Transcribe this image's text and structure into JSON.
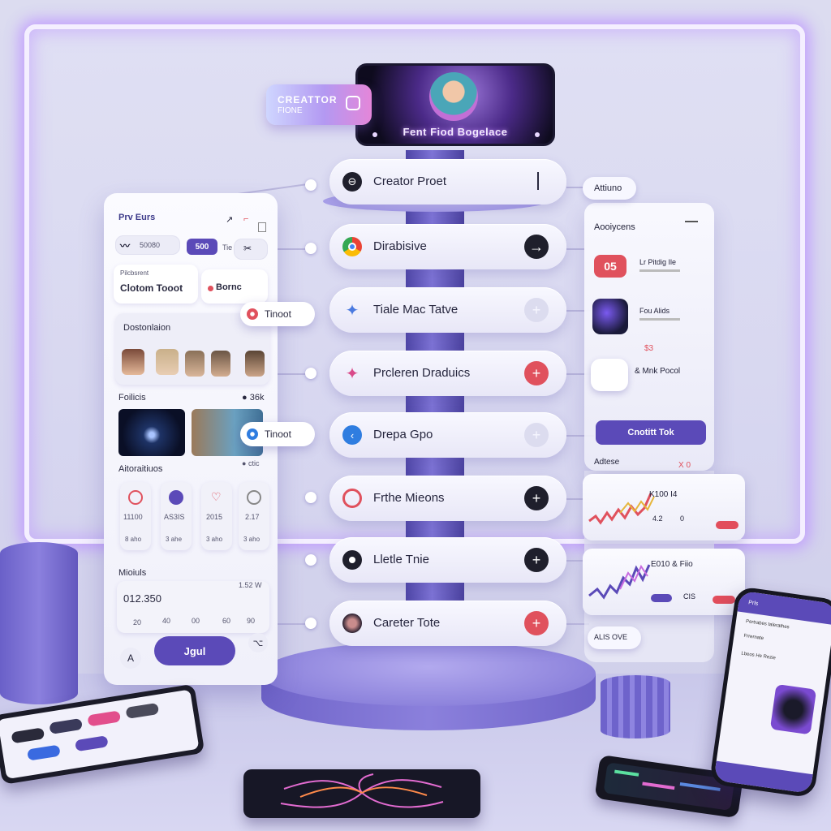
{
  "badge": {
    "line1": "CREATTOR",
    "line2": "FIONE"
  },
  "hero": {
    "title": "Fent Fiod Bogelace"
  },
  "pills": [
    {
      "label": "Creator Proet",
      "icon": "link-icon"
    },
    {
      "label": "Dirabisive",
      "icon": "chrome-icon"
    },
    {
      "label": "Tiale Mac Tatve",
      "icon": "gemini-icon"
    },
    {
      "label": "Prcleren Draduics",
      "icon": "gemini-icon"
    },
    {
      "label": "Drepa Gpo",
      "icon": "arrow-icon"
    },
    {
      "label": "Frthe Mieons",
      "icon": "ring-icon"
    },
    {
      "label": "Lletle Tnie",
      "icon": "record-icon"
    },
    {
      "label": "Careter Tote",
      "icon": "avatar-icon"
    }
  ],
  "float": {
    "left_pill": "Tinoot",
    "mid_pill": "Tinoot",
    "top_right_tag": "Attiuno"
  },
  "left_panel": {
    "title": "Prv Eurs",
    "balance": "50080",
    "btn_label": "500",
    "col_hint": "Tie",
    "card1_sub": "Pilcbsrent",
    "card1_title": "Clotom Tooot",
    "card2_title": "Bornc",
    "section1": "Dostonlaion",
    "section2": "Foilicis",
    "section2_count": "36k",
    "section3": "Aitoraitiuos",
    "section3_count": "ctic",
    "stats": [
      {
        "value": "11100",
        "sub": "8 aho"
      },
      {
        "value": "AS3IS",
        "sub": "3 ahe"
      },
      {
        "value": "2015",
        "sub": "3 aho"
      },
      {
        "value": "2.17",
        "sub": "3 aho"
      }
    ],
    "section4": "Mioiuls",
    "amount": "012.350",
    "amount_right": "1.52 W",
    "axis": [
      "20",
      "40",
      "00",
      "60",
      "90"
    ],
    "button": "Jgul",
    "avatar_letter": "A"
  },
  "right_panel": {
    "title": "Aooiycens",
    "row1_badge": "05",
    "row1_title": "Lr Pitdig Ile",
    "row2_title": "Fou Alids",
    "row3_price": "$3",
    "row3_title": "& Mnk Pocol",
    "cta": "Cnotitt Tok",
    "section": "Adtese",
    "section_mark": "X 0",
    "bottom_tag": "ALIS OVE"
  },
  "charts": [
    {
      "label": "K100 I4",
      "sub": "4.2",
      "sub2": "0"
    },
    {
      "label": "E010 & Fiio",
      "sub": "CIS"
    }
  ],
  "phone_right": {
    "header": "Prls",
    "row1": "Pertrabes talerathes",
    "row2": "Frrernate",
    "row3": "Lbeos He Rezie"
  },
  "colors": {
    "accent": "#5b4ab8",
    "red": "#e0515d",
    "dark": "#1f1f2c"
  }
}
